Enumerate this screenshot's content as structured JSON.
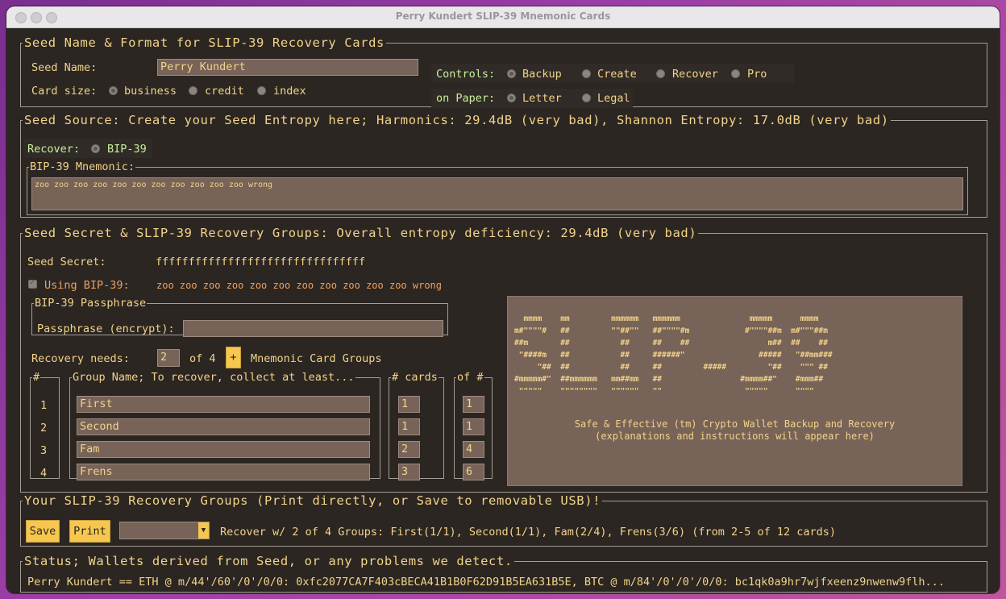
{
  "window": {
    "title": "Perry Kundert SLIP-39 Mnemonic Cards"
  },
  "seed_name_format": {
    "legend": "Seed Name & Format for SLIP-39 Recovery Cards",
    "seed_name_label": "Seed Name:",
    "seed_name_value": "Perry Kundert",
    "card_size_label": "Card size:",
    "card_sizes": [
      "business",
      "credit",
      "index"
    ],
    "card_size_selected": "business",
    "controls_label": "Controls:",
    "controls": [
      "Backup",
      "Create",
      "Recover",
      "Pro"
    ],
    "controls_selected": "Backup",
    "paper_label": "on Paper:",
    "papers": [
      "Letter",
      "Legal"
    ],
    "paper_selected": "Letter"
  },
  "seed_source": {
    "legend": "Seed Source: Create your Seed Entropy here; Harmonics: 29.4dB (very bad), Shannon Entropy: 17.0dB (very bad)",
    "recover_label": "Recover:",
    "recover_option": "BIP-39",
    "mnemonic_legend": "BIP-39 Mnemonic:",
    "mnemonic_value": "zoo zoo zoo zoo zoo zoo zoo zoo zoo zoo zoo wrong"
  },
  "seed_secret": {
    "legend": "Seed Secret & SLIP-39 Recovery Groups: Overall entropy deficiency: 29.4dB (very bad)",
    "secret_label": "Seed Secret:",
    "secret_value": "ffffffffffffffffffffffffffffffff",
    "using_label": "Using BIP-39:",
    "using_value": "zoo zoo zoo zoo zoo zoo zoo zoo zoo zoo zoo wrong",
    "passphrase_legend": "BIP-39 Passphrase",
    "passphrase_label": "Passphrase (encrypt):",
    "passphrase_value": "",
    "needs_label": "Recovery needs:",
    "needs_value": "2",
    "of_label": "of 4",
    "plus_label": "+",
    "groups_label": "Mnemonic Card Groups",
    "col_num": "#",
    "col_name": "Group Name; To recover, collect at least...",
    "col_cards": "# cards",
    "col_of": "of #",
    "groups": [
      {
        "num": "1",
        "name": "First",
        "cards": "1",
        "of": "1"
      },
      {
        "num": "2",
        "name": "Second",
        "cards": "1",
        "of": "1"
      },
      {
        "num": "3",
        "name": "Fam",
        "cards": "2",
        "of": "4"
      },
      {
        "num": "4",
        "name": "Frens",
        "cards": "3",
        "of": "6"
      }
    ],
    "ascii_art": "  mmmm    mm         mmmmmm   mmmmmm               mmmmm      mmmm\nm#\"\"\"\"#   ##         \"\"##\"\"   ##\"\"\"\"#m            #\"\"\"\"##m  m#\"\"\"##m\n##m       ##           ##     ##    ##                 m##  ##    ##\n \"####m   ##           ##     ######\"                #####   \"##mm###\n     \"##  ##           ##     ##         #####         \"##    \"\"\" ##\n#mmmmm#\"  ##mmmmmm   mm##mm   ##                 #mmmm##\"    #mmm##\n \"\"\"\"\"    \"\"\"\"\"\"\"\"   \"\"\"\"\"\"   \"\"                  \"\"\"\"\"      \"\"\"\"",
    "info_line1": "Safe & Effective (tm) Crypto Wallet Backup and Recovery",
    "info_line2": "(explanations and instructions will appear here)"
  },
  "recovery_groups": {
    "legend": "Your SLIP-39 Recovery Groups (Print directly, or Save to removable USB)!",
    "save_label": "Save",
    "print_label": "Print",
    "summary": "Recover w/ 2 of 4 Groups: First(1/1), Second(1/1), Fam(2/4), Frens(3/6) (from 2-5 of 12 cards)"
  },
  "status": {
    "legend": "Status; Wallets derived from Seed, or any problems we detect.",
    "text": "Perry Kundert == ETH @ m/44'/60'/0'/0/0: 0xfc2077CA7F403cBECA41B1B0F62D91B5EA631B5E, BTC @ m/84'/0'/0'/0/0: bc1qk0a9hr7wjfxeenz9nwenw9flh..."
  },
  "colors": {
    "background": "#2b2622",
    "text": "#f3d38a",
    "field": "#786358",
    "button": "#f7c64e",
    "control_label": "#c9ef9a",
    "using_label": "#f0a060"
  }
}
